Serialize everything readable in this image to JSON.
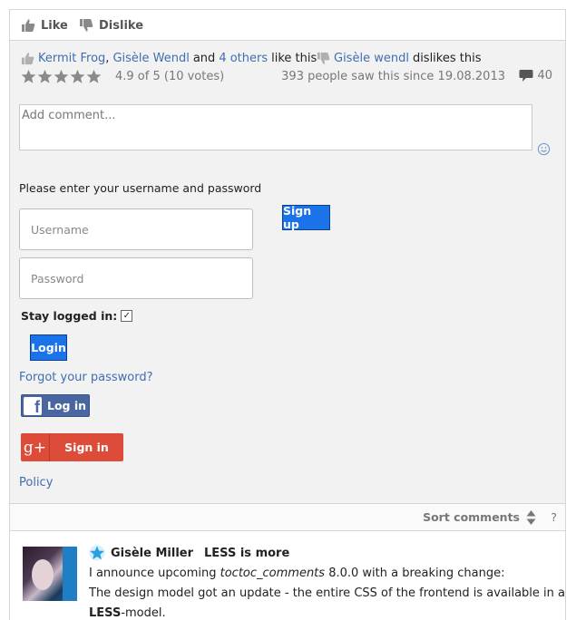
{
  "topbar": {
    "like_label": "Like",
    "dislike_label": "Dislike"
  },
  "likes": {
    "user1": "Kermit Frog",
    "separator": ",",
    "user2": "Gisèle Wendl",
    "and_text": "and",
    "others_link": "4 others",
    "suffix": "like this"
  },
  "dislikes": {
    "user": "Gisèle wendl",
    "suffix": "dislikes this"
  },
  "rating": {
    "stars_filled": 5,
    "stars_total": 5,
    "text": "4.9 of 5 (10 votes)"
  },
  "views_text": "393 people saw this since 19.08.2013",
  "comment_count": "40",
  "comment_input": {
    "placeholder": "Add comment..."
  },
  "login": {
    "prompt": "Please enter your username and password",
    "username_placeholder": "Username",
    "password_placeholder": "Password",
    "signup_label": "Sign up",
    "stay_logged_label": "Stay logged in:",
    "stay_logged_checked": true,
    "checkbox_mark": "✓",
    "login_label": "Login",
    "forgot_label": "Forgot your password?",
    "facebook_label": "Log in",
    "facebook_icon_glyph": "f",
    "google_label": "Sign in",
    "google_icon_glyph": "g+",
    "policy_label": "Policy"
  },
  "sort": {
    "label": "Sort comments",
    "help": "?"
  },
  "comment": {
    "author": "Gisèle Miller",
    "title": "LESS is more",
    "line1_prefix": "I announce upcoming",
    "line1_italic": "toctoc_comments",
    "line1_suffix": "8.0.0 with a breaking change:",
    "line2": "The design model got an update - the entire CSS of the frontend is available in a",
    "line3_bold": "LESS",
    "line3_suffix": "-model."
  },
  "colors": {
    "accent_blue": "#1a73e8",
    "link_blue": "#3f6eb0",
    "facebook": "#4a66a0",
    "google": "#dd4b39",
    "star_gray": "#8a8a8a",
    "panel_bg": "#f2f2f2"
  }
}
